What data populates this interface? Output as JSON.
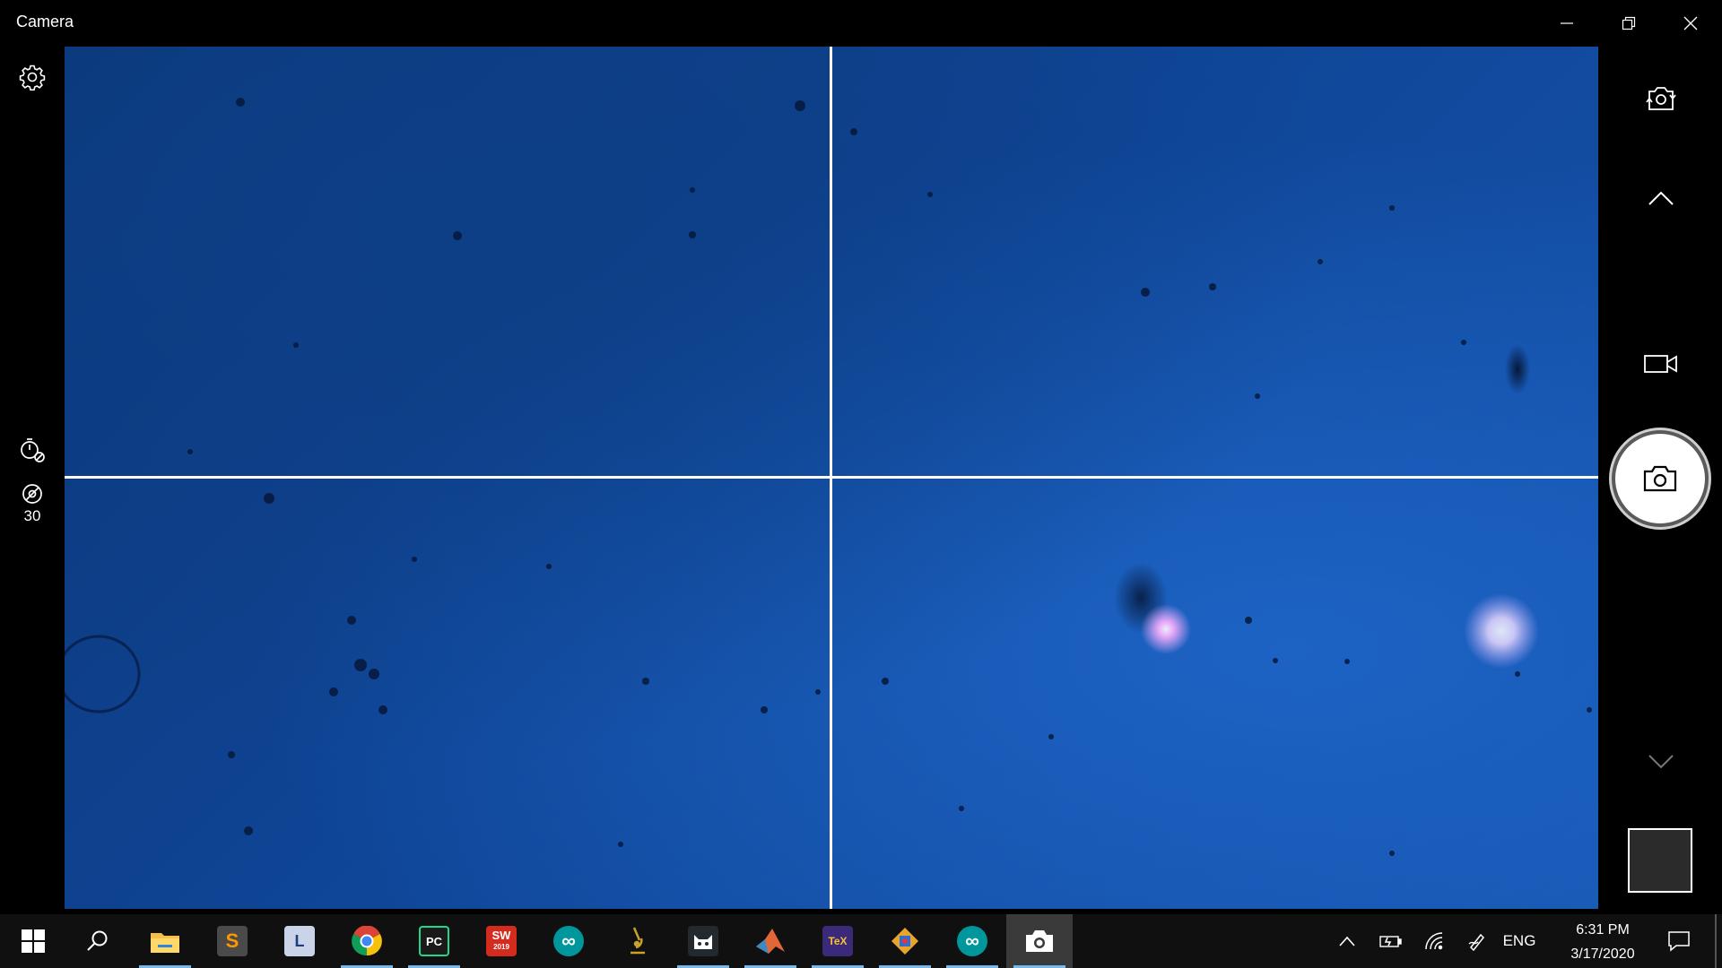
{
  "window": {
    "title": "Camera",
    "minimize_icon": "minimize-icon",
    "restore_icon": "restore-icon",
    "close_icon": "close-icon"
  },
  "left_rail": {
    "settings_icon": "gear-icon",
    "timer_icon": "timer-off-icon",
    "hdr_icon": "hdr-off-icon",
    "hdr_value": "30"
  },
  "right_rail": {
    "switch_camera_icon": "switch-camera-icon",
    "scroll_up_icon": "chevron-up-icon",
    "video_mode_icon": "video-camera-icon",
    "photo_shutter_icon": "camera-icon",
    "scroll_down_icon": "chevron-down-icon",
    "gallery_thumbnail": "last-photo-thumbnail"
  },
  "viewfinder": {
    "framing_grid": "crosshair"
  },
  "taskbar": {
    "start_icon": "windows-start-icon",
    "search_icon": "search-icon",
    "apps": [
      {
        "name": "File Explorer",
        "icon": "folder-icon",
        "label": "",
        "color": "#f3c14b",
        "running": true
      },
      {
        "name": "Sublime Text",
        "icon": "sublime-icon",
        "label": "S",
        "color": "#4a4a4a",
        "running": false
      },
      {
        "name": "Docs app",
        "icon": "document-icon",
        "label": "L",
        "color": "#c9d4e8",
        "running": false
      },
      {
        "name": "Google Chrome",
        "icon": "chrome-icon",
        "label": "",
        "color": "#4285f4",
        "running": true
      },
      {
        "name": "PyCharm",
        "icon": "pycharm-icon",
        "label": "PC",
        "color": "#1a1a1a",
        "running": true
      },
      {
        "name": "SolidWorks 2019",
        "icon": "solidworks-icon",
        "label": "SW",
        "sublabel": "2019",
        "color": "#d52b1e",
        "running": false
      },
      {
        "name": "Arduino",
        "icon": "arduino-icon",
        "label": "∞",
        "color": "#00979c",
        "running": false
      },
      {
        "name": "Microscope",
        "icon": "microscope-icon",
        "label": "",
        "color": "#c9a227",
        "running": false
      },
      {
        "name": "GitHub Desktop",
        "icon": "github-icon",
        "label": "",
        "color": "#24292e",
        "running": true
      },
      {
        "name": "MATLAB",
        "icon": "matlab-icon",
        "label": "",
        "color": "#e16737",
        "running": true
      },
      {
        "name": "TeXstudio",
        "icon": "tex-icon",
        "label": "TeX",
        "color": "#3b2a7a",
        "running": true
      },
      {
        "name": "Diagram tool",
        "icon": "diagram-icon",
        "label": "",
        "color": "#e9a52b",
        "running": true
      },
      {
        "name": "Arduino",
        "icon": "arduino-icon",
        "label": "∞",
        "color": "#00979c",
        "running": true
      },
      {
        "name": "Camera",
        "icon": "camera-icon",
        "label": "",
        "color": "#ffffff",
        "running": true,
        "active": true
      }
    ],
    "tray": {
      "show_hidden_icon": "chevron-up-icon",
      "battery_icon": "battery-charging-icon",
      "network_icon": "wifi-icon",
      "pen_icon": "pen-icon",
      "language": "ENG",
      "time": "6:31 PM",
      "date": "3/17/2020",
      "notifications_icon": "action-center-icon"
    }
  }
}
